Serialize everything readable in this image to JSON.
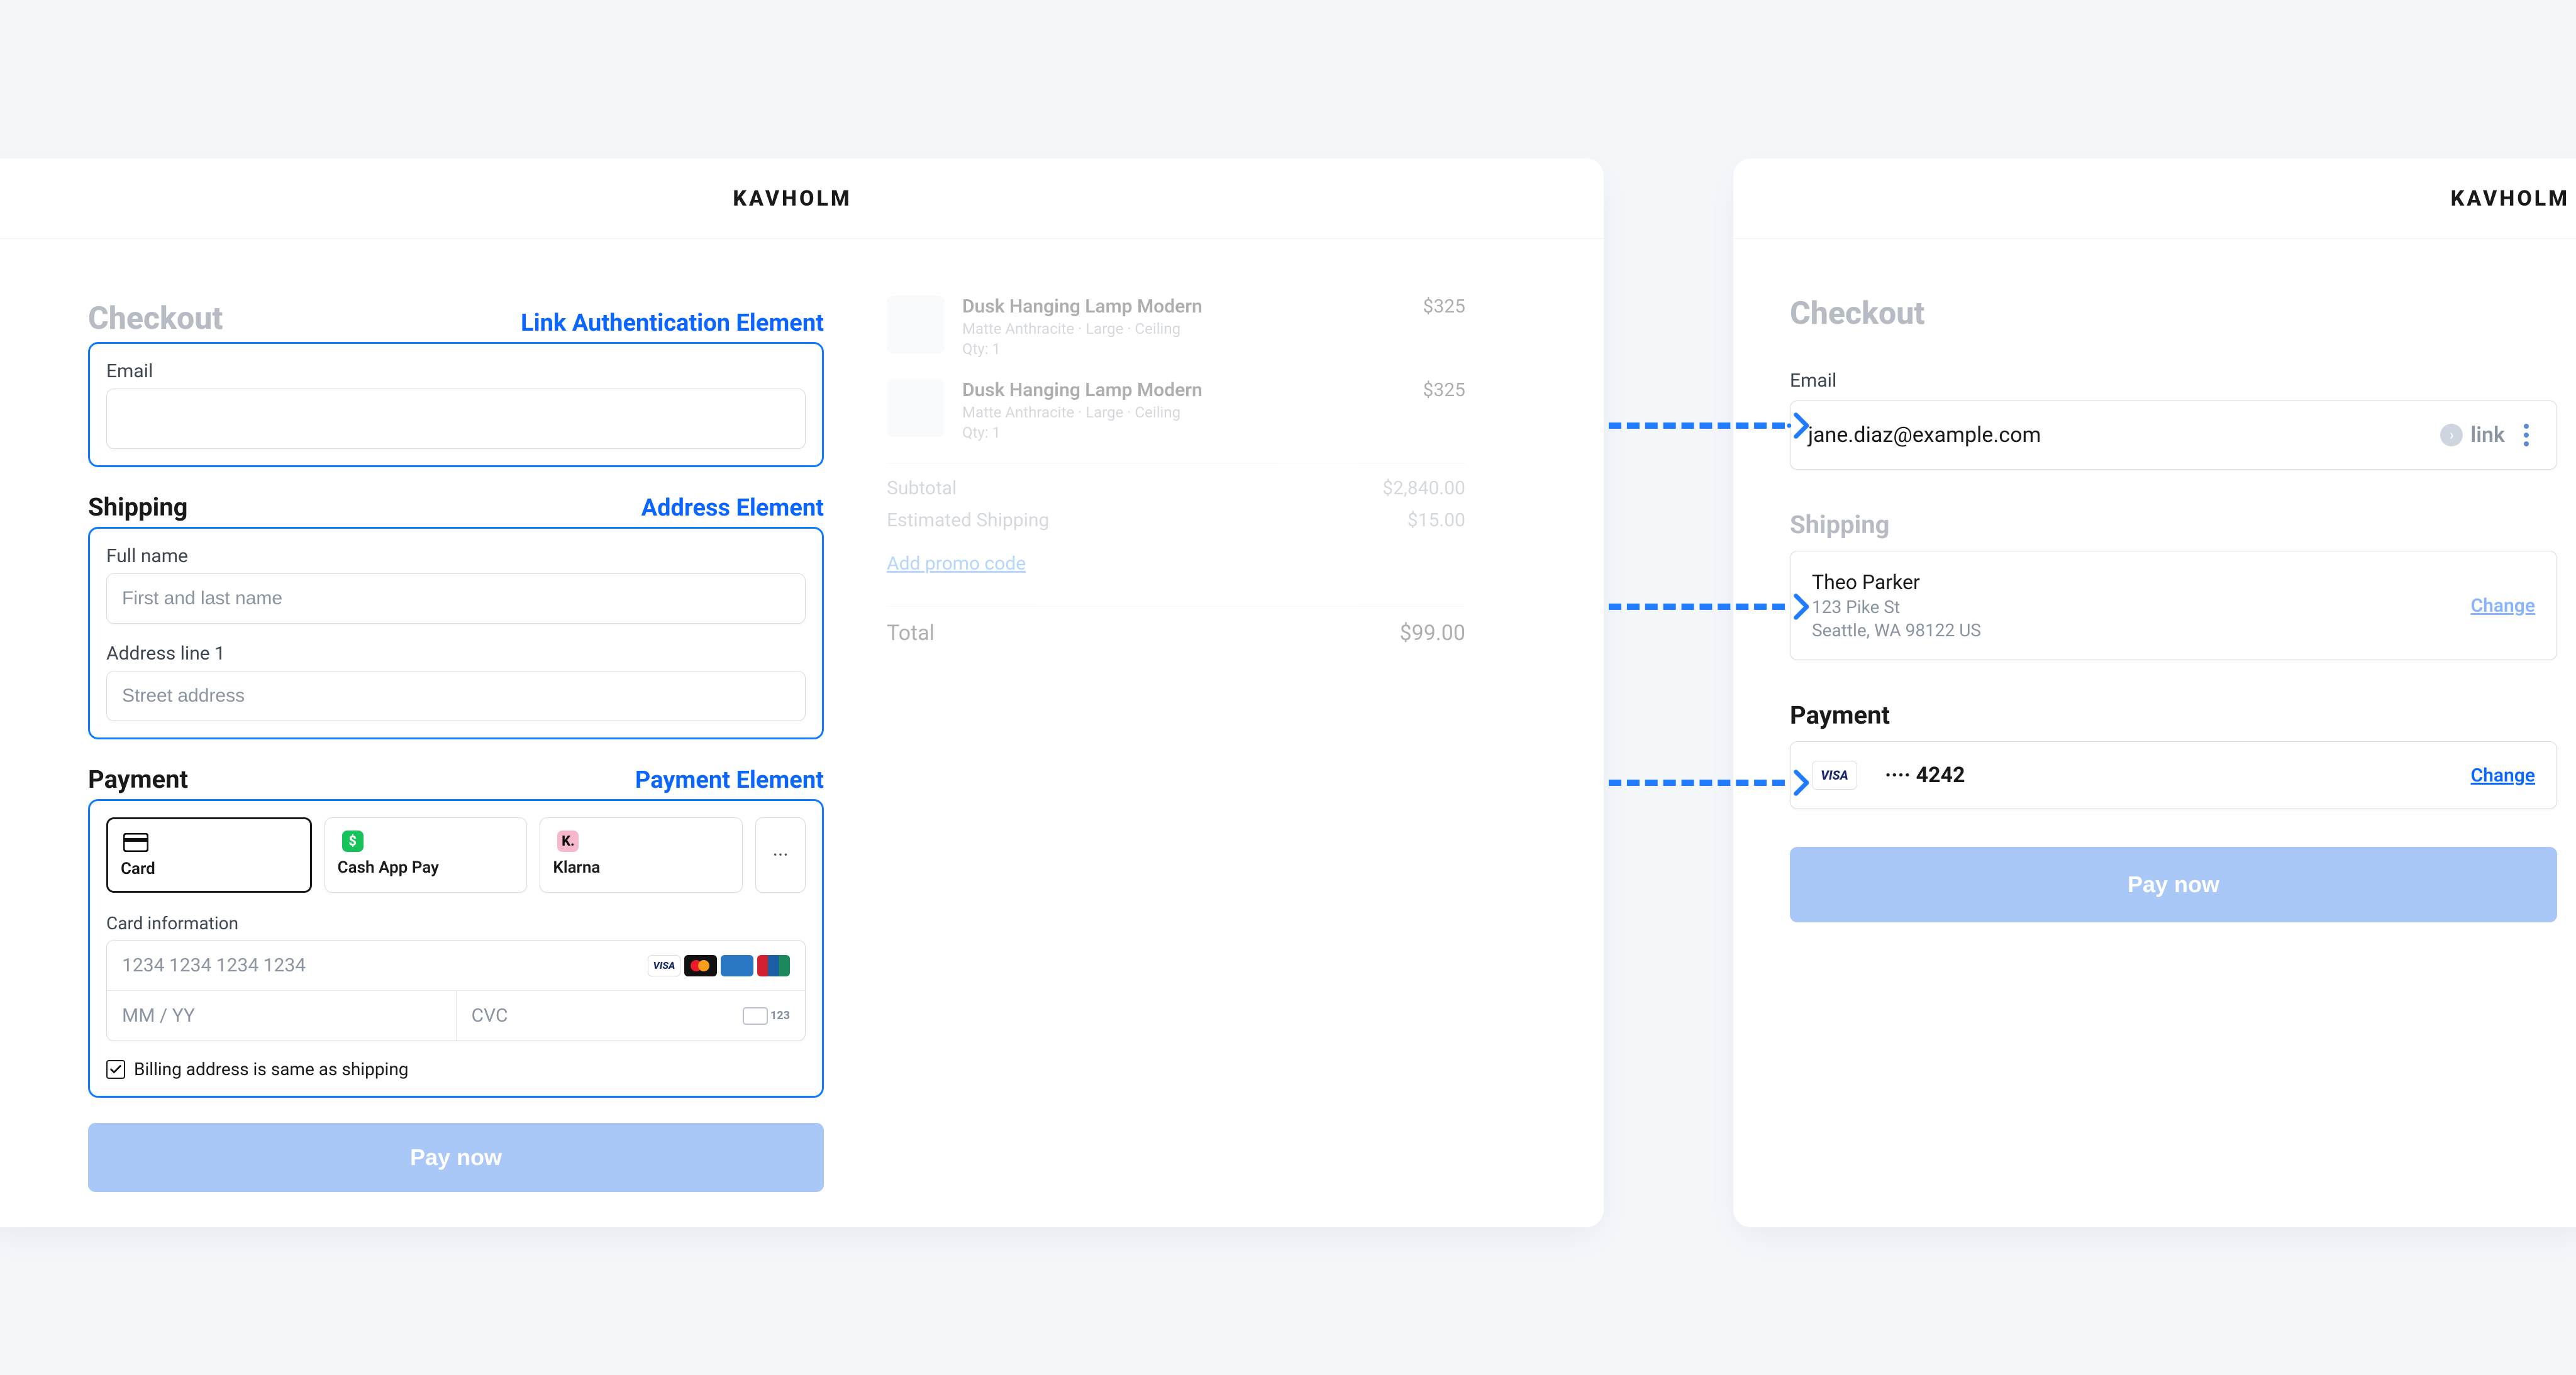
{
  "brand": "KAVHOLM",
  "left": {
    "checkout_title": "Checkout",
    "badges": {
      "link_auth": "Link Authentication Element",
      "address": "Address Element",
      "payment": "Payment Element"
    },
    "sections": {
      "shipping_name": "Shipping",
      "payment_name": "Payment"
    },
    "email_label": "Email",
    "fullname_label": "Full name",
    "fullname_ph": "First and last name",
    "addr1_label": "Address line 1",
    "addr1_ph": "Street address",
    "pm": {
      "card": "Card",
      "cashapp": "Cash App Pay",
      "klarna": "Klarna",
      "more_glyph": "···"
    },
    "card_info_label": "Card information",
    "card_num_ph": "1234 1234 1234 1234",
    "card_exp_ph": "MM / YY",
    "card_cvc_ph": "CVC",
    "billing_same_label": "Billing address is same as shipping",
    "pay_now": "Pay now",
    "summary": {
      "items": [
        {
          "title": "Dusk Hanging Lamp Modern",
          "variant": "Matte Anthracite · Large · Ceiling",
          "qty": "Qty: 1",
          "price": "$325"
        },
        {
          "title": "Dusk Hanging Lamp Modern",
          "variant": "Matte Anthracite · Large · Ceiling",
          "qty": "Qty: 1",
          "price": "$325"
        }
      ],
      "subtotal_label": "Subtotal",
      "subtotal_value": "$2,840.00",
      "ship_label": "Estimated Shipping",
      "ship_value": "$15.00",
      "promo_link": "Add promo code",
      "total_label": "Total",
      "total_value": "$99.00"
    }
  },
  "right": {
    "checkout_title": "Checkout",
    "email_label": "Email",
    "email_value": "jane.diaz@example.com",
    "link_label": "link",
    "shipping_title": "Shipping",
    "shipping": {
      "name": "Theo Parker",
      "line1": "123 Pike St",
      "line2": "Seattle, WA 98122 US",
      "change": "Change"
    },
    "payment_title": "Payment",
    "payment": {
      "brand": "VISA",
      "mask": "···· 4242",
      "change": "Change"
    },
    "pay_now": "Pay now"
  }
}
